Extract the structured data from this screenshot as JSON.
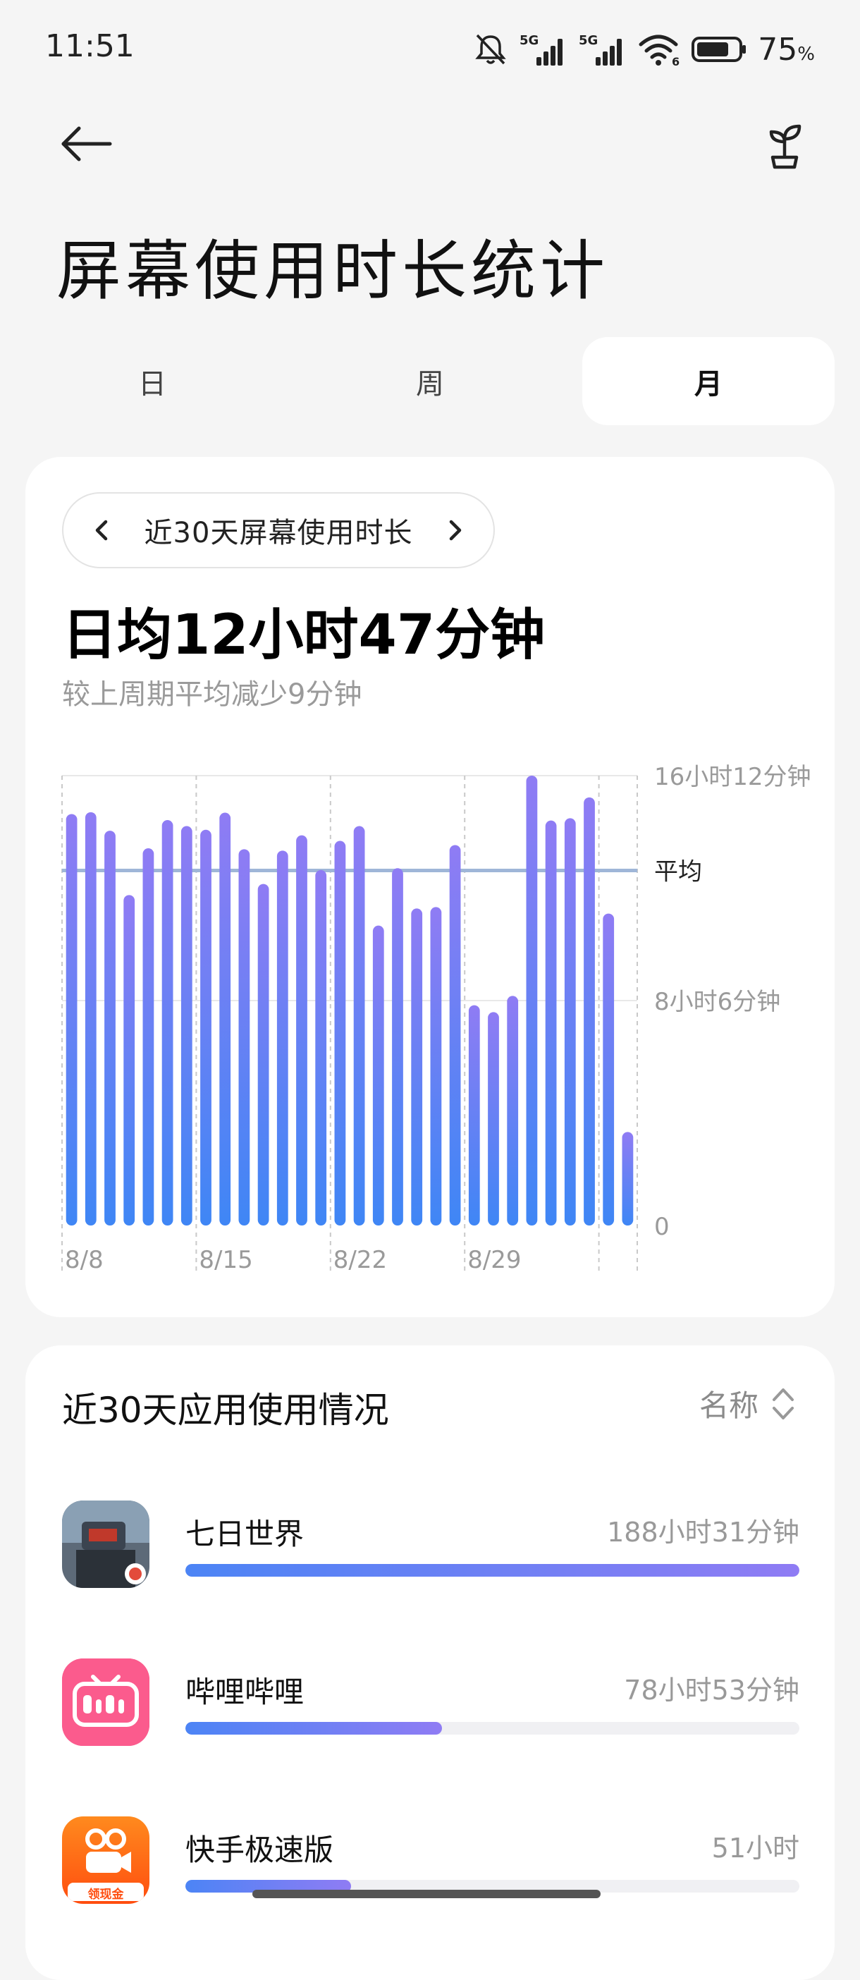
{
  "status_bar": {
    "time": "11:51",
    "battery_percent": "75",
    "battery_unit": "%",
    "network_1": "5G",
    "network_2": "5G",
    "wifi_badge": "6",
    "icons": [
      "mute-icon",
      "signal-icon",
      "wifi-icon",
      "battery-icon"
    ]
  },
  "header": {
    "back_icon": "arrow-left-icon",
    "title": "屏幕使用时长统计",
    "action_icon": "sprout-icon"
  },
  "tabs": [
    {
      "label": "日",
      "active": false
    },
    {
      "label": "周",
      "active": false
    },
    {
      "label": "月",
      "active": true
    }
  ],
  "summary": {
    "range_label": "近30天屏幕使用时长",
    "average": "日均12小时47分钟",
    "compare": "较上周期平均减少9分钟"
  },
  "chart_data": {
    "type": "bar",
    "categories": [
      "8/8",
      "8/9",
      "8/10",
      "8/11",
      "8/12",
      "8/13",
      "8/14",
      "8/15",
      "8/16",
      "8/17",
      "8/18",
      "8/19",
      "8/20",
      "8/21",
      "8/22",
      "8/23",
      "8/24",
      "8/25",
      "8/26",
      "8/27",
      "8/28",
      "8/29",
      "8/30",
      "8/31",
      "9/1",
      "9/2",
      "9/3",
      "9/4",
      "9/5",
      "9/6"
    ],
    "series": [
      {
        "values_minutes": [
          889,
          893,
          853,
          714,
          815,
          876,
          863,
          855,
          892,
          813,
          738,
          810,
          843,
          768,
          831,
          863,
          648,
          772,
          685,
          688,
          822,
          476,
          461,
          496,
          972,
          875,
          880,
          925,
          674,
          202
        ]
      }
    ],
    "x_tick_labels": [
      "8/8",
      "8/15",
      "8/22",
      "8/29"
    ],
    "y_tick_labels": [
      "16小时12分钟",
      "8小时6分钟",
      "0"
    ],
    "ylim_minutes": [
      0,
      972
    ],
    "average_minutes": 767,
    "average_label": "平均",
    "bar_color_top": "#8f7cf4",
    "bar_color_bottom": "#3f86f5",
    "average_line_color": "#9fb6d8",
    "grid": true
  },
  "app_usage": {
    "title": "近30天应用使用情况",
    "sort_label": "名称",
    "sort_icon": "sort-updown-icon",
    "apps": [
      {
        "name": "七日世界",
        "time": "188小时31分钟",
        "fraction": 1.0,
        "icon": "qiri-world-icon"
      },
      {
        "name": "哔哩哔哩",
        "time": "78小时53分钟",
        "fraction": 0.418,
        "icon": "bilibili-icon"
      },
      {
        "name": "快手极速版",
        "time": "51小时",
        "fraction": 0.27,
        "icon": "kuaishou-icon",
        "icon_badge": "领现金"
      }
    ]
  }
}
